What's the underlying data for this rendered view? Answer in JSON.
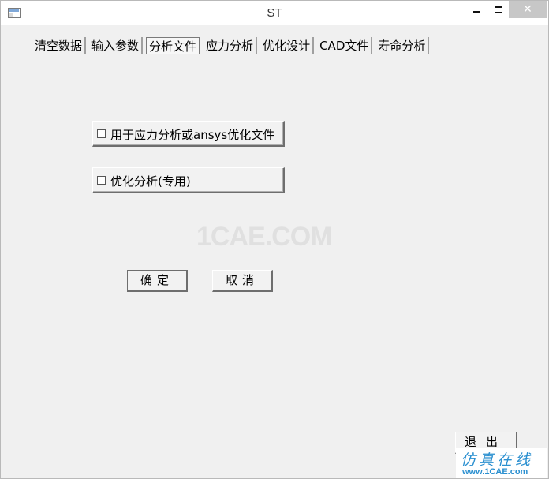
{
  "window": {
    "title": "ST",
    "minimize_icon": "minimize-icon",
    "maximize_icon": "maximize-icon",
    "close_label": "✕"
  },
  "tabs": [
    {
      "label": "清空数据"
    },
    {
      "label": "输入参数"
    },
    {
      "label": "分析文件",
      "active": true
    },
    {
      "label": "应力分析"
    },
    {
      "label": "优化设计"
    },
    {
      "label": "CAD文件"
    },
    {
      "label": "寿命分析"
    }
  ],
  "options": {
    "stress_file_label": "用于应力分析或ansys优化文件",
    "optimize_label": "优化分析(专用)"
  },
  "watermark": "1CAE.COM",
  "buttons": {
    "ok_label": "确定",
    "cancel_label": "取消",
    "exit_label": "退出"
  },
  "logo": {
    "cn": "仿真在线",
    "en": "www.1CAE.com"
  },
  "colors": {
    "logo": "#2a8fd0",
    "window_bg": "#f0f0f0"
  }
}
